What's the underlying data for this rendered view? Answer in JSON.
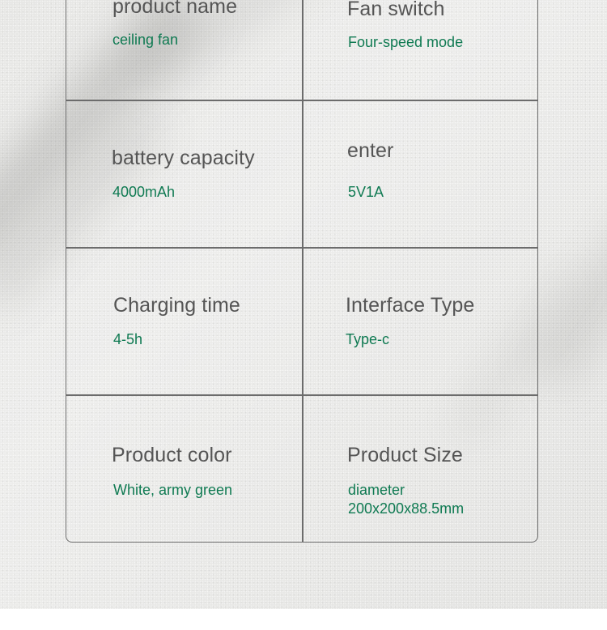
{
  "specs": [
    {
      "label": "product name",
      "value": "ceiling fan"
    },
    {
      "label": "Fan switch",
      "value": "Four-speed mode"
    },
    {
      "label": "battery capacity",
      "value": "4000mAh"
    },
    {
      "label": "enter",
      "value": "5V1A"
    },
    {
      "label": "Charging time",
      "value": "4-5h"
    },
    {
      "label": "Interface Type",
      "value": "Type-c"
    },
    {
      "label": "Product color",
      "value": "White, army green"
    },
    {
      "label": "Product Size",
      "value": "diameter",
      "value_line2": "200x200x88.5mm"
    }
  ],
  "colors": {
    "label": "#555555",
    "value": "#0f7a52",
    "border": "#6c6c6c",
    "background": "#e7e7e5"
  }
}
